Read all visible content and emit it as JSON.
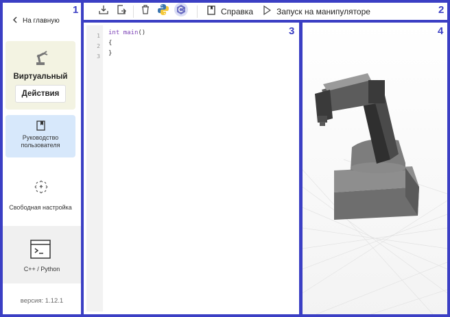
{
  "sidebar": {
    "back_label": "На главную",
    "virtual_label": "Виртуальный",
    "actions_label": "Действия",
    "guide_label_line1": "Руководство",
    "guide_label_line2": "пользователя",
    "free_label": "Свободная настройка",
    "cpp_label": "C++ / Python",
    "version": "версия: 1.12.1"
  },
  "toolbar": {
    "help_label": "Справка",
    "run_label": "Запуск на манипуляторе"
  },
  "editor": {
    "line_numbers": [
      "1",
      "2",
      "3"
    ],
    "line1_kw": "int",
    "line1_fn": "main",
    "line1_rest": "()",
    "line2": "{",
    "line3": "}"
  },
  "panel_numbers": [
    "1",
    "2",
    "3",
    "4"
  ],
  "colors": {
    "frame": "#3b3fc4",
    "virtual_card": "#f3f3e2",
    "guide_card": "#d7e8fb",
    "python_blue": "#3a75b0",
    "python_yellow": "#f5c838",
    "cpp_badge": "#6b6ec2"
  }
}
